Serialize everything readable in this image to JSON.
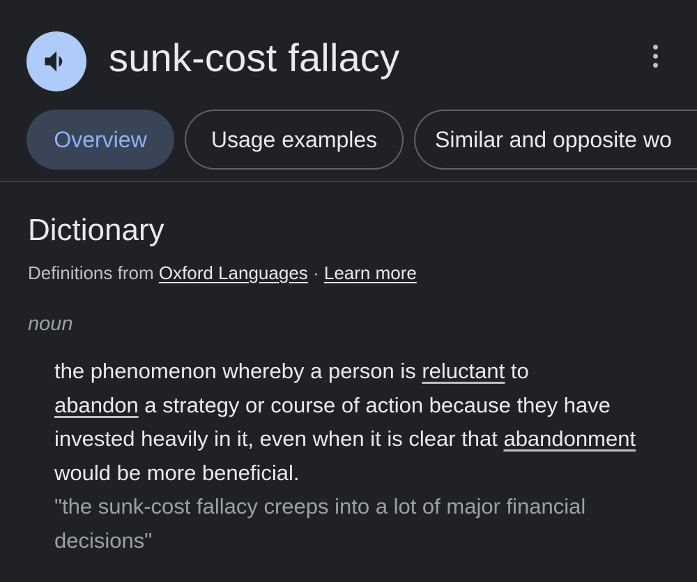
{
  "header": {
    "term": "sunk-cost fallacy",
    "speaker_icon": "volume-up-icon",
    "more_icon": "more-vert-icon"
  },
  "tabs": [
    {
      "label": "Overview",
      "active": true
    },
    {
      "label": "Usage examples",
      "active": false
    },
    {
      "label": "Similar and opposite wo",
      "active": false
    }
  ],
  "dictionary": {
    "title": "Dictionary",
    "source_prefix": "Definitions from ",
    "source_link": "Oxford Languages",
    "separator": " · ",
    "learn_more": "Learn more",
    "part_of_speech": "noun",
    "definition": {
      "t1": "the phenomenon whereby a person is ",
      "link1": "reluctant",
      "t2": " to ",
      "link2": "abandon",
      "t3": " a strategy or course of action because they have invested heavily in it, even when it is clear that ",
      "link3": "abandonment",
      "t4": " would be more beneficial."
    },
    "example": "\"the sunk-cost fallacy creeps into a lot of major financial decisions\""
  },
  "colors": {
    "background": "#202124",
    "accent": "#8ab4f8",
    "speaker_bg": "#aecbfa",
    "active_tab_bg": "#394457"
  }
}
